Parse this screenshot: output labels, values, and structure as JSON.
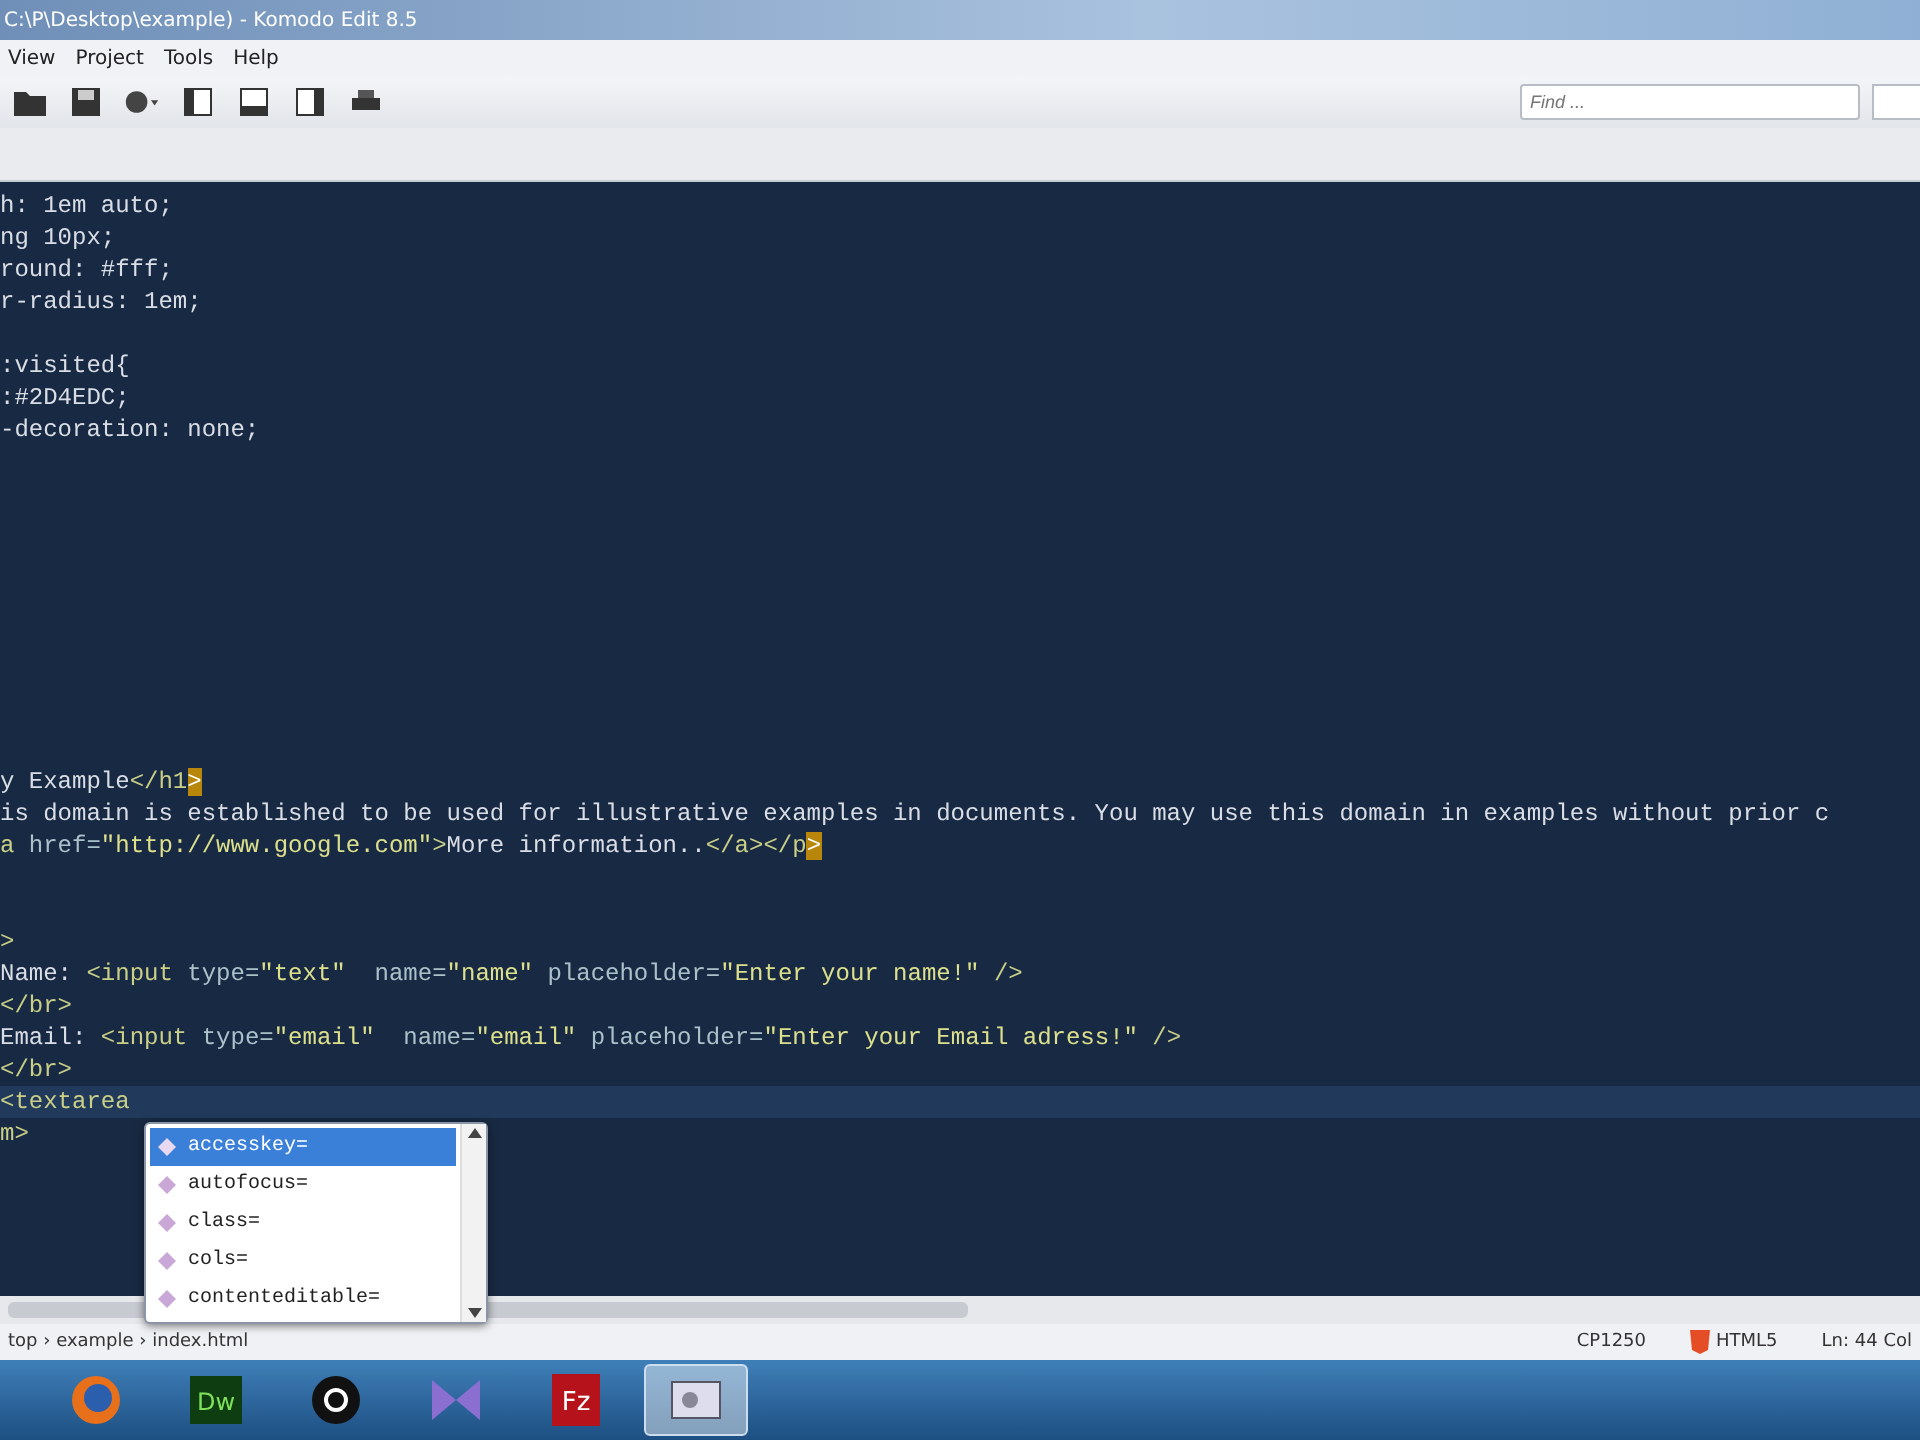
{
  "window": {
    "title": "C:\\P\\Desktop\\example) - Komodo Edit 8.5"
  },
  "menu": [
    {
      "label": "View"
    },
    {
      "label": "Project"
    },
    {
      "label": "Tools"
    },
    {
      "label": "Help"
    }
  ],
  "find": {
    "placeholder": "Find ..."
  },
  "editor": {
    "lines": [
      {
        "kind": "code",
        "current": false,
        "segments": [
          {
            "kind": "plain",
            "text": "h: 1em auto;"
          }
        ]
      },
      {
        "kind": "code",
        "current": false,
        "segments": [
          {
            "kind": "plain",
            "text": "ng 10px;"
          }
        ]
      },
      {
        "kind": "code",
        "current": false,
        "segments": [
          {
            "kind": "plain",
            "text": "round: #fff;"
          }
        ]
      },
      {
        "kind": "code",
        "current": false,
        "segments": [
          {
            "kind": "plain",
            "text": "r-radius: 1em;"
          }
        ]
      },
      {
        "kind": "blank"
      },
      {
        "kind": "code",
        "current": false,
        "segments": [
          {
            "kind": "plain",
            "text": ":visited{"
          }
        ]
      },
      {
        "kind": "code",
        "current": false,
        "segments": [
          {
            "kind": "plain",
            "text": ":#2D4EDC;"
          }
        ]
      },
      {
        "kind": "code",
        "current": false,
        "segments": [
          {
            "kind": "plain",
            "text": "-decoration: none;"
          }
        ]
      },
      {
        "kind": "blank"
      },
      {
        "kind": "blank"
      },
      {
        "kind": "blank"
      },
      {
        "kind": "blank"
      },
      {
        "kind": "blank"
      },
      {
        "kind": "blank"
      },
      {
        "kind": "blank"
      },
      {
        "kind": "blank"
      },
      {
        "kind": "blank"
      },
      {
        "kind": "blank"
      },
      {
        "kind": "code",
        "current": false,
        "segments": [
          {
            "kind": "plain",
            "text": "y Example"
          },
          {
            "kind": "tag",
            "text": "</h1"
          },
          {
            "kind": "bracket",
            "text": ">"
          }
        ]
      },
      {
        "kind": "code",
        "current": false,
        "segments": [
          {
            "kind": "plain",
            "text": "is domain is established to be used for illustrative examples in documents. You may use this domain in examples without prior c"
          }
        ]
      },
      {
        "kind": "code",
        "current": false,
        "segments": [
          {
            "kind": "tag",
            "text": "a "
          },
          {
            "kind": "attr",
            "text": "href="
          },
          {
            "kind": "string",
            "text": "\"http://www.google.com\""
          },
          {
            "kind": "tag",
            "text": ">"
          },
          {
            "kind": "plain",
            "text": "More information.."
          },
          {
            "kind": "tag",
            "text": "</a></p"
          },
          {
            "kind": "bracket",
            "text": ">"
          }
        ]
      },
      {
        "kind": "blank"
      },
      {
        "kind": "blank"
      },
      {
        "kind": "code",
        "current": false,
        "segments": [
          {
            "kind": "tag",
            "text": ">"
          }
        ]
      },
      {
        "kind": "code",
        "current": false,
        "segments": [
          {
            "kind": "plain",
            "text": "Name: "
          },
          {
            "kind": "tag",
            "text": "<input "
          },
          {
            "kind": "attr",
            "text": "type="
          },
          {
            "kind": "string",
            "text": "\"text\""
          },
          {
            "kind": "attr",
            "text": "  name="
          },
          {
            "kind": "string",
            "text": "\"name\""
          },
          {
            "kind": "attr",
            "text": " placeholder="
          },
          {
            "kind": "string",
            "text": "\"Enter your name!\""
          },
          {
            "kind": "tag",
            "text": " />"
          }
        ]
      },
      {
        "kind": "code",
        "current": false,
        "segments": [
          {
            "kind": "tag",
            "text": "</br>"
          }
        ]
      },
      {
        "kind": "code",
        "current": false,
        "segments": [
          {
            "kind": "plain",
            "text": "Email: "
          },
          {
            "kind": "tag",
            "text": "<input "
          },
          {
            "kind": "attr",
            "text": "type="
          },
          {
            "kind": "string",
            "text": "\"email\""
          },
          {
            "kind": "attr",
            "text": "  name="
          },
          {
            "kind": "string",
            "text": "\"email\""
          },
          {
            "kind": "attr",
            "text": " placeholder="
          },
          {
            "kind": "string",
            "text": "\"Enter your Email adress!\""
          },
          {
            "kind": "tag",
            "text": " />"
          }
        ]
      },
      {
        "kind": "code",
        "current": false,
        "segments": [
          {
            "kind": "tag",
            "text": "</br>"
          }
        ]
      },
      {
        "kind": "code",
        "current": true,
        "segments": [
          {
            "kind": "tag",
            "text": "<textarea"
          }
        ]
      },
      {
        "kind": "code",
        "current": false,
        "segments": [
          {
            "kind": "tag",
            "text": "m>"
          }
        ]
      }
    ]
  },
  "autocomplete": {
    "items": [
      {
        "label": "accesskey=",
        "selected": true
      },
      {
        "label": "autofocus=",
        "selected": false
      },
      {
        "label": "class=",
        "selected": false
      },
      {
        "label": "cols=",
        "selected": false
      },
      {
        "label": "contenteditable=",
        "selected": false
      }
    ]
  },
  "status_bar": {
    "breadcrumb": "top › example › index.html",
    "encoding": "CP1250",
    "language": "HTML5",
    "position": "Ln: 44 Col"
  },
  "taskbar": {
    "apps": [
      {
        "kind": "firefox",
        "active": false
      },
      {
        "kind": "dw",
        "label": "Dw",
        "active": false
      },
      {
        "kind": "obs",
        "active": false
      },
      {
        "kind": "vs",
        "active": false
      },
      {
        "kind": "filezilla",
        "label": "Fz",
        "active": false
      },
      {
        "kind": "app",
        "active": true
      }
    ]
  }
}
